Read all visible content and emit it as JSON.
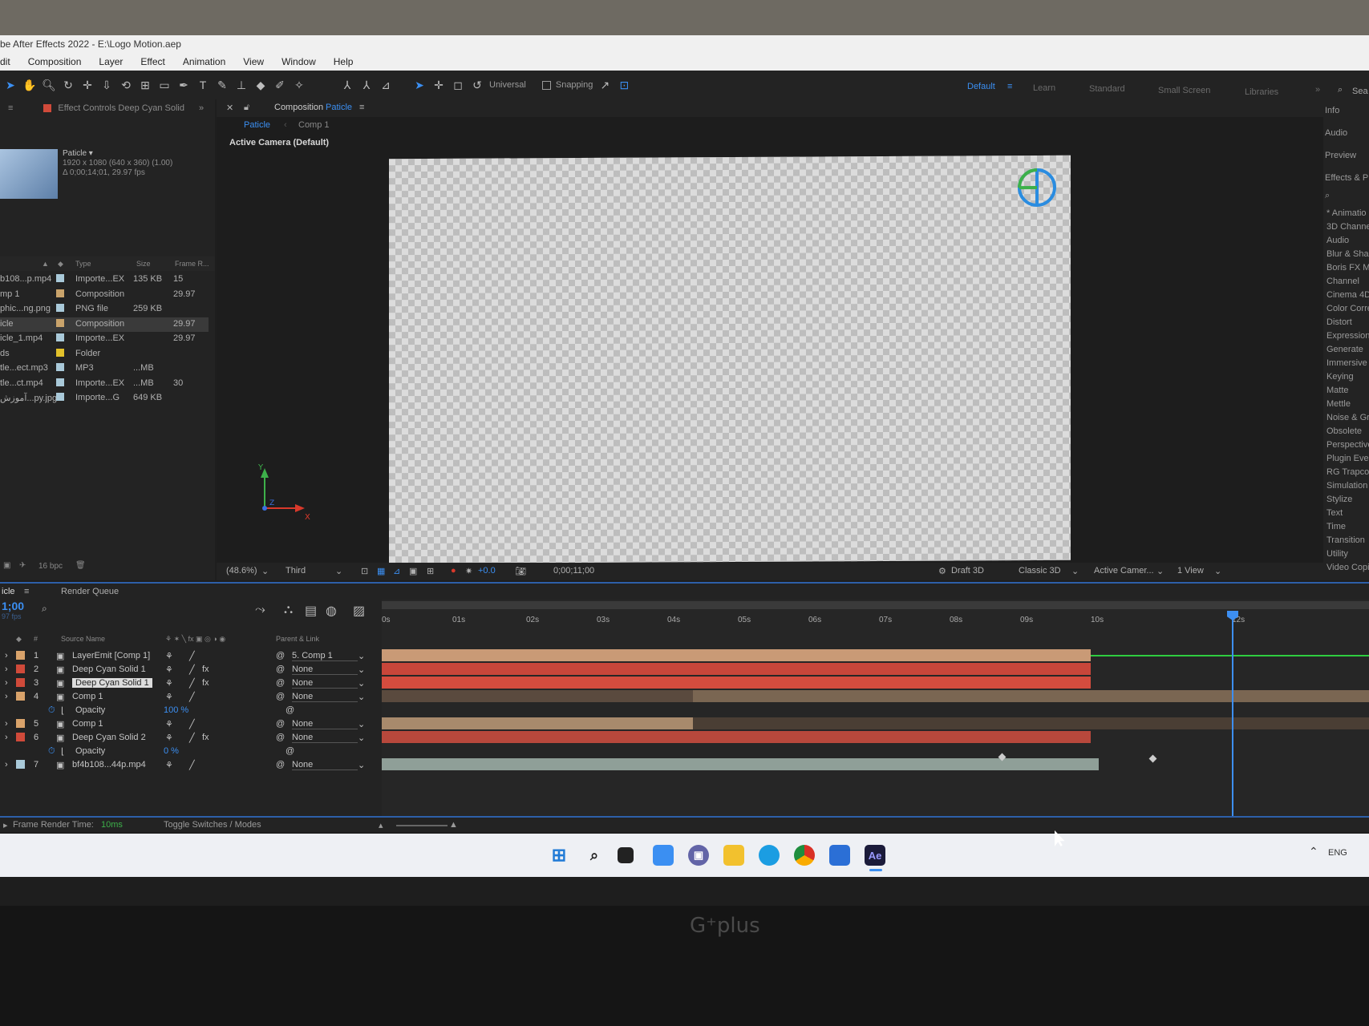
{
  "app": {
    "title": "be After Effects 2022 - E:\\Logo Motion.aep",
    "menu": [
      "dit",
      "Composition",
      "Layer",
      "Effect",
      "Animation",
      "View",
      "Window",
      "Help"
    ]
  },
  "toolbar": {
    "universal_label": "Universal",
    "snapping_label": "Snapping",
    "workspaces": [
      "Default",
      "Learn",
      "Standard",
      "Small Screen",
      "Libraries"
    ],
    "search_label": "Sea"
  },
  "project": {
    "effect_controls_tab": "Effect Controls Deep Cyan Solid",
    "item_name": "Paticle ▾",
    "item_info_1": "1920 x 1080  (640 x 360) (1.00)",
    "item_info_2": "Δ 0;00;14;01, 29.97 fps",
    "columns": {
      "type": "Type",
      "size": "Size",
      "frame_rate": "Frame R..."
    },
    "items": [
      {
        "name": "b108...p.mp4",
        "type": "Importe...EX",
        "size": "135 KB",
        "fps": "15",
        "color": "#a9c9d9"
      },
      {
        "name": "mp 1",
        "type": "Composition",
        "size": "",
        "fps": "29.97",
        "color": "#c9a36b"
      },
      {
        "name": "phic...ng.png",
        "type": "PNG file",
        "size": "259 KB",
        "fps": "",
        "color": "#a9c9d9"
      },
      {
        "name": "icle",
        "type": "Composition",
        "size": "",
        "fps": "29.97",
        "color": "#c9a36b"
      },
      {
        "name": "icle_1.mp4",
        "type": "Importe...EX",
        "size": "",
        "fps": "29.97",
        "color": "#a9c9d9"
      },
      {
        "name": "ds",
        "type": "Folder",
        "size": "",
        "fps": "",
        "color": "#e2c12b"
      },
      {
        "name": "tle...ect.mp3",
        "type": "MP3",
        "size": "...MB",
        "fps": "",
        "color": "#a9c9d9"
      },
      {
        "name": "tle...ct.mp4",
        "type": "Importe...EX",
        "size": "...MB",
        "fps": "30",
        "color": "#a9c9d9"
      },
      {
        "name": "آموزش...py.jpg",
        "type": "Importe...G",
        "size": "649 KB",
        "fps": "",
        "color": "#a9c9d9"
      }
    ],
    "bpc": "16 bpc"
  },
  "composition": {
    "tab_label": "Composition",
    "tab_comp": "Paticle",
    "breadcrumb": [
      "Paticle",
      "Comp 1"
    ],
    "camera_label": "Active Camera (Default)",
    "zoom": "(48.6%)",
    "resolution": "Third",
    "exposure": "+0.0",
    "timecode": "0;00;11;00",
    "renderer": "Draft 3D",
    "renderer_mode": "Classic 3D",
    "camera_select": "Active Camer...",
    "view_select": "1 View"
  },
  "effects_panel": {
    "tabs": [
      "Info",
      "Audio",
      "Preview",
      "Effects & P"
    ],
    "categories": [
      "* Animatio",
      "3D Channe",
      "Audio",
      "Blur & Sha",
      "Boris FX M",
      "Channel",
      "Cinema 4D",
      "Color Corre",
      "Distort",
      "Expression",
      "Generate",
      "Immersive",
      "Keying",
      "Matte",
      "Mettle",
      "Noise & Gr",
      "Obsolete",
      "Perspective",
      "Plugin Ever",
      "RG Trapcod",
      "Simulation",
      "Stylize",
      "Text",
      "Time",
      "Transition",
      "Utility",
      "Video Copil"
    ]
  },
  "timeline": {
    "tab_label": "icle",
    "render_queue_label": "Render Queue",
    "current_time": "1;00",
    "fps_hint": "97 fps",
    "col_source": "Source Name",
    "col_parent": "Parent & Link",
    "ruler": [
      "0s",
      "01s",
      "02s",
      "03s",
      "04s",
      "05s",
      "06s",
      "07s",
      "08s",
      "09s",
      "10s",
      "12s"
    ],
    "layers": [
      {
        "num": "1",
        "name": "LayerEmit [Comp 1]",
        "color": "#d9a36b",
        "parent": "5. Comp 1",
        "fx": false
      },
      {
        "num": "2",
        "name": "Deep Cyan Solid 1",
        "color": "#d04a3a",
        "parent": "None",
        "fx": true
      },
      {
        "num": "3",
        "name": "Deep Cyan Solid 1",
        "color": "#d04a3a",
        "parent": "None",
        "fx": true
      },
      {
        "num": "4",
        "name": "Comp 1",
        "color": "#d9a36b",
        "parent": "None",
        "fx": false
      },
      {
        "num": "",
        "name": "Opacity",
        "value": "100 %",
        "prop": true
      },
      {
        "num": "5",
        "name": "Comp 1",
        "color": "#d9a36b",
        "parent": "None",
        "fx": false
      },
      {
        "num": "6",
        "name": "Deep Cyan Solid 2",
        "color": "#d04a3a",
        "parent": "None",
        "fx": true
      },
      {
        "num": "",
        "name": "Opacity",
        "value": "0 %",
        "prop": true
      },
      {
        "num": "7",
        "name": "bf4b108...44p.mp4",
        "color": "#a9c9d9",
        "parent": "None",
        "fx": false
      }
    ],
    "frame_render_label": "Frame Render Time:",
    "frame_render_value": "10ms",
    "toggle_label": "Toggle Switches / Modes"
  },
  "taskbar": {
    "lang": "ENG",
    "ae_label": "Ae"
  }
}
